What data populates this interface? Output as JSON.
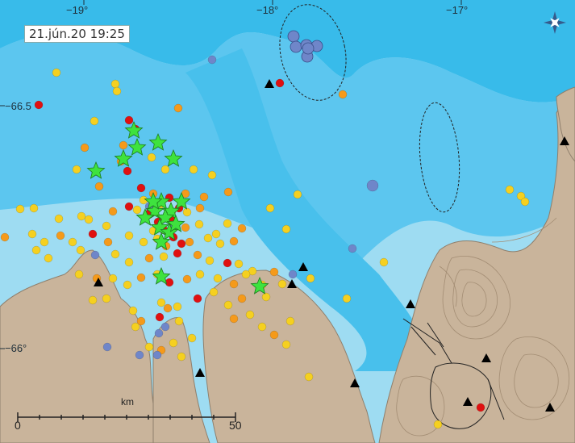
{
  "map": {
    "timestamp": "21.jún.20  19:25",
    "longitude_labels": [
      "−19°",
      "−18°",
      "−17°"
    ],
    "latitude_labels": [
      "−66.5",
      "−66°"
    ],
    "scale": {
      "unit": "km",
      "min": "0",
      "max": "50"
    },
    "compass_icon": "compass-star-icon",
    "colors": {
      "sea_deep": "#2fb7ea",
      "sea_mid": "#6fcdf0",
      "sea_shallow": "#9edcf2",
      "land": "#c9b49b",
      "event_red": "#e01010",
      "event_orange": "#f59a1a",
      "event_yellow": "#f5d020",
      "event_blue": "#6f86c9",
      "large_event_star": "#3ee23e",
      "station_triangle": "#000000"
    },
    "legend_categories": [
      "red: recent events",
      "orange",
      "yellow",
      "blue: older events",
      "green star: larger events",
      "triangle: seismic station"
    ]
  }
}
